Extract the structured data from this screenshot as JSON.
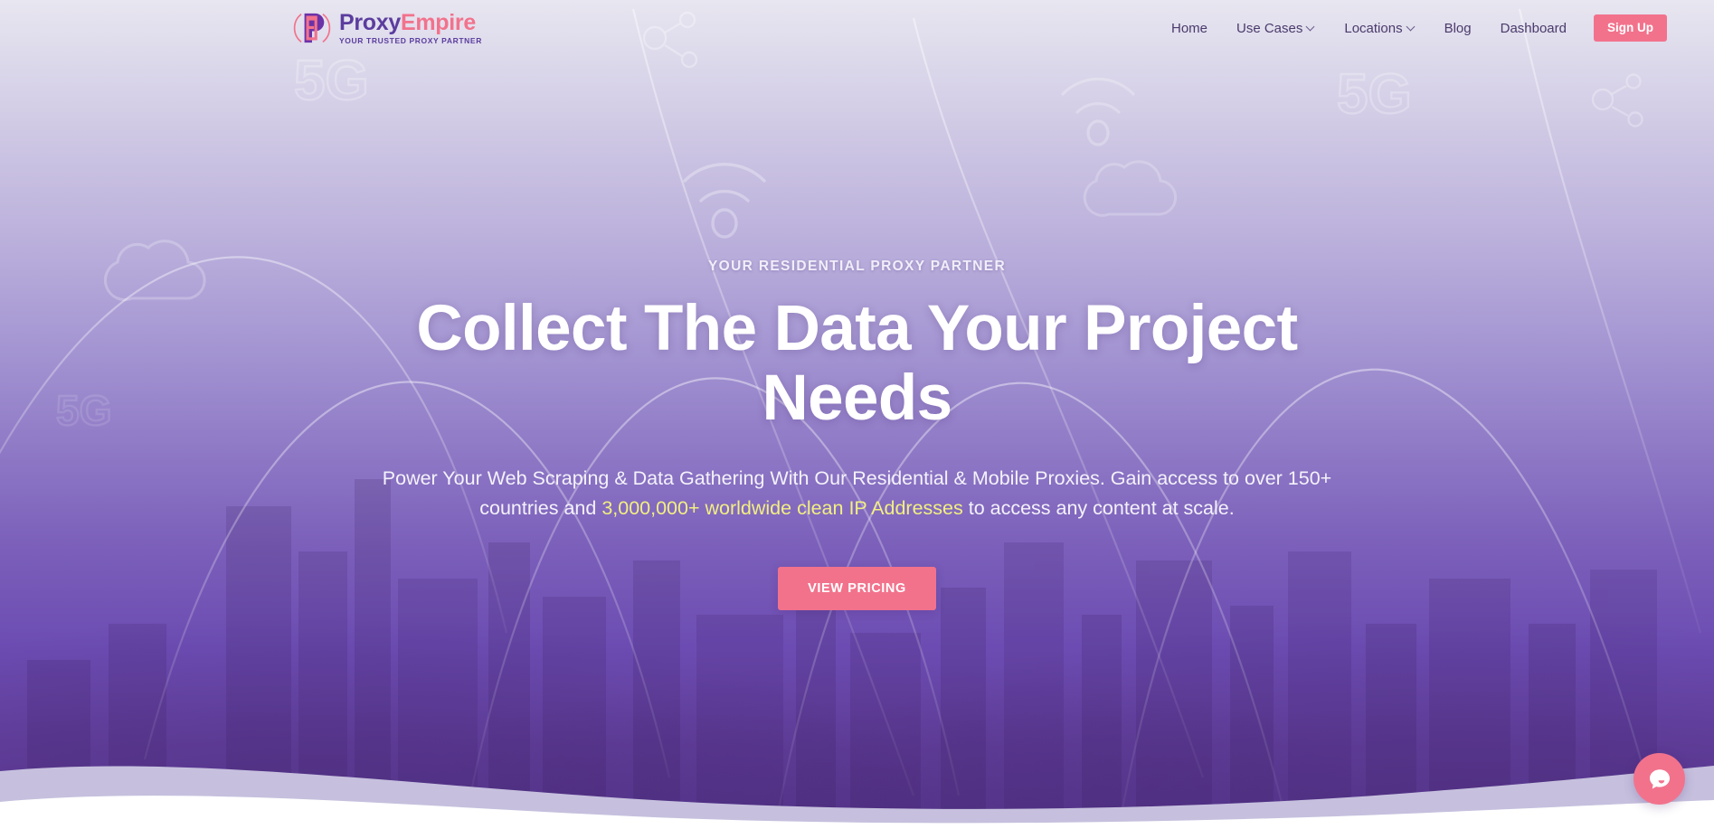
{
  "brand": {
    "logo_icon": "proxyempire-logo-icon",
    "name_part1": "Proxy",
    "name_part2": "Empire",
    "tagline": "YOUR TRUSTED PROXY PARTNER",
    "purple": "#5b3d9e",
    "pink": "#f2728c"
  },
  "nav": {
    "items": [
      {
        "label": "Home",
        "has_dropdown": false
      },
      {
        "label": "Use Cases",
        "has_dropdown": true
      },
      {
        "label": "Locations",
        "has_dropdown": true
      },
      {
        "label": "Blog",
        "has_dropdown": false
      },
      {
        "label": "Dashboard",
        "has_dropdown": false
      }
    ],
    "signup_label": "Sign Up"
  },
  "hero": {
    "eyebrow": "YOUR RESIDENTIAL PROXY PARTNER",
    "headline": "Collect The Data Your Project Needs",
    "subline_part1": "Power Your Web Scraping & Data Gathering  With Our Residential & Mobile Proxies. Gain access to over 150+ countries and ",
    "subline_highlight": "3,000,000+ worldwide clean IP Addresses",
    "subline_part2": " to access any content at scale.",
    "highlight_color": "#f2ef82",
    "cta_label": "VIEW PRICING",
    "cta_color": "#f2728c",
    "background_decorations": [
      "5g-text",
      "wifi-icon",
      "cloud-icon",
      "network-node-icon",
      "signal-arc-lines",
      "city-skyline"
    ]
  },
  "chat": {
    "icon": "chat-bubble-icon",
    "color": "#f2728c"
  }
}
